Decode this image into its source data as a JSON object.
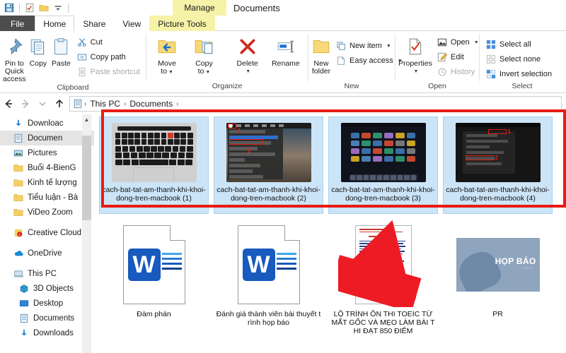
{
  "window": {
    "title": "Documents",
    "context_tab_group": "Manage",
    "quick_access": [
      "save-icon",
      "properties-icon",
      "new-folder-icon",
      "customize-qat-icon"
    ]
  },
  "tabs": [
    {
      "label": "File",
      "kind": "file"
    },
    {
      "label": "Home",
      "kind": "active"
    },
    {
      "label": "Share",
      "kind": "normal"
    },
    {
      "label": "View",
      "kind": "normal"
    },
    {
      "label": "Picture Tools",
      "kind": "context"
    }
  ],
  "ribbon": {
    "groups": [
      {
        "label": "Clipboard",
        "big": [
          {
            "label": "Pin to Quick\naccess",
            "label_line1": "Pin to Quick",
            "label_line2": "access",
            "icon": "pin-icon",
            "dim": false
          },
          {
            "label": "Copy",
            "icon": "copy-icon",
            "dim": false
          },
          {
            "label": "Paste",
            "icon": "paste-icon",
            "dim": false
          }
        ],
        "small": [
          {
            "label": "Cut",
            "icon": "scissors-icon",
            "dim": false
          },
          {
            "label": "Copy path",
            "icon": "copy-path-icon",
            "dim": false
          },
          {
            "label": "Paste shortcut",
            "icon": "paste-shortcut-icon",
            "dim": true
          }
        ]
      },
      {
        "label": "Organize",
        "big": [
          {
            "label_line1": "Move",
            "label_line2": "to",
            "icon": "move-to-icon",
            "caret": true
          },
          {
            "label_line1": "Copy",
            "label_line2": "to",
            "icon": "copy-to-icon",
            "caret": true
          },
          {
            "label_line1": "Delete",
            "label_line2": "",
            "icon": "delete-icon",
            "caret": true
          },
          {
            "label_line1": "Rename",
            "label_line2": "",
            "icon": "rename-icon",
            "caret": false
          }
        ],
        "small": []
      },
      {
        "label": "New",
        "big": [
          {
            "label_line1": "New",
            "label_line2": "folder",
            "icon": "new-folder-icon",
            "caret": false
          }
        ],
        "small": [
          {
            "label": "New item",
            "icon": "new-item-icon",
            "caret": true,
            "dim": false
          },
          {
            "label": "Easy access",
            "icon": "easy-access-icon",
            "caret": true,
            "dim": false
          }
        ]
      },
      {
        "label": "Open",
        "big": [
          {
            "label_line1": "Properties",
            "label_line2": "",
            "icon": "properties-icon",
            "caret": true
          }
        ],
        "small": [
          {
            "label": "Open",
            "icon": "open-icon",
            "caret": true,
            "dim": false
          },
          {
            "label": "Edit",
            "icon": "edit-icon",
            "caret": false,
            "dim": false
          },
          {
            "label": "History",
            "icon": "history-icon",
            "caret": false,
            "dim": true
          }
        ]
      },
      {
        "label": "Select",
        "big": [],
        "small": [
          {
            "label": "Select all",
            "icon": "select-all-icon",
            "dim": false
          },
          {
            "label": "Select none",
            "icon": "select-none-icon",
            "dim": false
          },
          {
            "label": "Invert selection",
            "icon": "invert-selection-icon",
            "dim": false
          }
        ]
      }
    ]
  },
  "address_bar": {
    "back": "back-arrow-icon",
    "forward": "forward-arrow-icon",
    "recent": "recent-locations-icon",
    "up": "up-arrow-icon",
    "crumb_icon": "documents-folder-icon",
    "crumbs": [
      "This PC",
      "Documents"
    ],
    "separator": "›"
  },
  "sidebar": {
    "items": [
      {
        "label": "Downloac",
        "icon": "download-icon",
        "pinned": true,
        "indent": 0,
        "selected": false
      },
      {
        "label": "Documen",
        "icon": "documents-icon",
        "pinned": true,
        "indent": 0,
        "selected": true
      },
      {
        "label": "Pictures",
        "icon": "pictures-icon",
        "pinned": true,
        "indent": 0,
        "selected": false
      },
      {
        "label": "Buổi 4-BienG",
        "icon": "folder-icon",
        "pinned": false,
        "indent": 0,
        "selected": false
      },
      {
        "label": "Kinh tế lượng",
        "icon": "folder-icon",
        "pinned": false,
        "indent": 0,
        "selected": false
      },
      {
        "label": "Tiểu luận - Bà",
        "icon": "folder-icon",
        "pinned": false,
        "indent": 0,
        "selected": false
      },
      {
        "label": "ViDeo Zoom",
        "icon": "folder-icon",
        "pinned": false,
        "indent": 0,
        "selected": false
      },
      {
        "label": "Creative Cloud",
        "icon": "creative-cloud-icon",
        "pinned": false,
        "indent": 0,
        "selected": false,
        "gap_before": true
      },
      {
        "label": "OneDrive",
        "icon": "onedrive-icon",
        "pinned": false,
        "indent": 0,
        "selected": false,
        "gap_before": true
      },
      {
        "label": "This PC",
        "icon": "this-pc-icon",
        "pinned": false,
        "indent": 0,
        "selected": false,
        "gap_before": true
      },
      {
        "label": "3D Objects",
        "icon": "3d-objects-icon",
        "pinned": false,
        "indent": 1,
        "selected": false
      },
      {
        "label": "Desktop",
        "icon": "desktop-icon",
        "pinned": false,
        "indent": 1,
        "selected": false
      },
      {
        "label": "Documents",
        "icon": "documents-icon",
        "pinned": false,
        "indent": 1,
        "selected": false
      },
      {
        "label": "Downloads",
        "icon": "download-icon",
        "pinned": false,
        "indent": 1,
        "selected": false
      }
    ]
  },
  "files": {
    "row1": [
      {
        "name": "cach-bat-tat-am-thanh-khi-khoi-dong-tren-macbook (1)",
        "thumb": "macbook-keyboard",
        "selected": true
      },
      {
        "name": "cach-bat-tat-am-thanh-khi-khoi-dong-tren-macbook (2)",
        "thumb": "mac-apple-menu",
        "selected": true
      },
      {
        "name": "cach-bat-tat-am-thanh-khi-khoi-dong-tren-macbook (3)",
        "thumb": "mac-desktop",
        "selected": true
      },
      {
        "name": "cach-bat-tat-am-thanh-khi-khoi-dong-tren-macbook (4)",
        "thumb": "mac-dark-panel",
        "selected": true
      }
    ],
    "row2": [
      {
        "name": "Đàm phán",
        "thumb": "word-document",
        "selected": false
      },
      {
        "name": "Đánh giá thành viên bài thuyết trình họp báo",
        "thumb": "word-document",
        "selected": false
      },
      {
        "name": "LỘ TRÌNH ÔN THI TOEIC TỪ MẤT GỐC VÀ MẸO LÀM BÀI THI ĐẠT 850 ĐIỂM",
        "thumb": "pdf-document",
        "selected": false
      },
      {
        "name": "PR",
        "thumb": "presentation-thumb",
        "thumb_text": "HỌP BÁO",
        "selected": false
      }
    ]
  },
  "annotations": {
    "highlight_box_color": "#e81b16",
    "arrow_color": "#ed1c24"
  }
}
